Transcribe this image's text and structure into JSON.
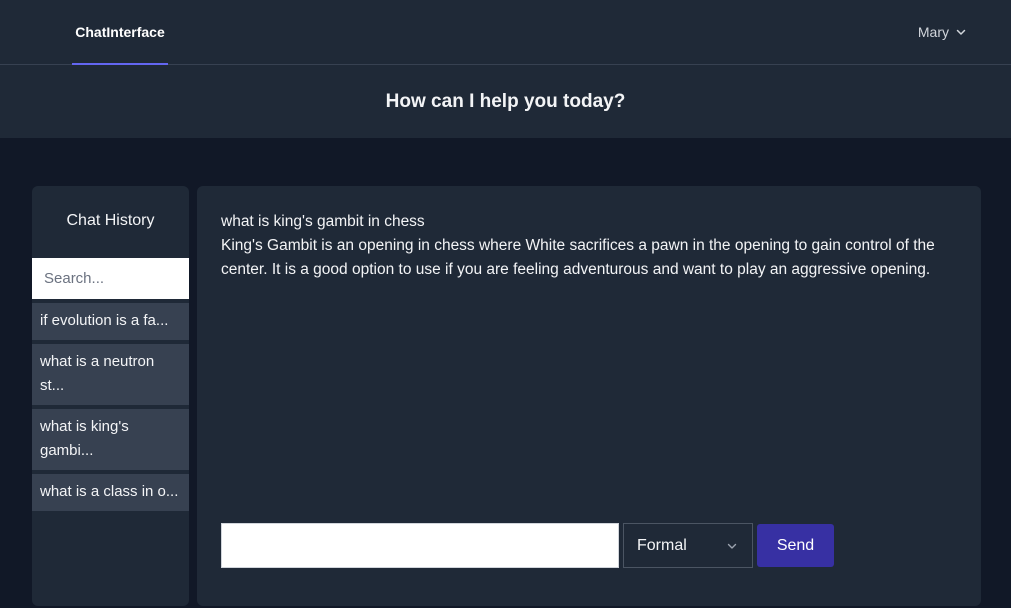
{
  "nav": {
    "brand": "ChatInterface",
    "user": "Mary"
  },
  "hero": {
    "title": "How can I help you today?"
  },
  "sidebar": {
    "title": "Chat History",
    "search_placeholder": "Search...",
    "items": [
      {
        "label": "if evolution is a fa..."
      },
      {
        "label": "what is a neutron st..."
      },
      {
        "label": "what is king's gambi..."
      },
      {
        "label": "what is a class in o..."
      }
    ]
  },
  "conversation": {
    "question": "what is king's gambit in chess",
    "answer": "King's Gambit is an opening in chess where White sacrifices a pawn in the opening to gain control of the center. It is a good option to use if you are feeling adventurous and want to play an aggressive opening."
  },
  "composer": {
    "input_value": "",
    "tone_selected": "Formal",
    "send_label": "Send"
  },
  "colors": {
    "accent": "#6366f1",
    "send": "#3730a3",
    "panel": "#1f2937",
    "background": "#111827"
  },
  "icons": {
    "user_menu": "chevron-down-icon",
    "tone_select": "chevron-down-icon"
  }
}
